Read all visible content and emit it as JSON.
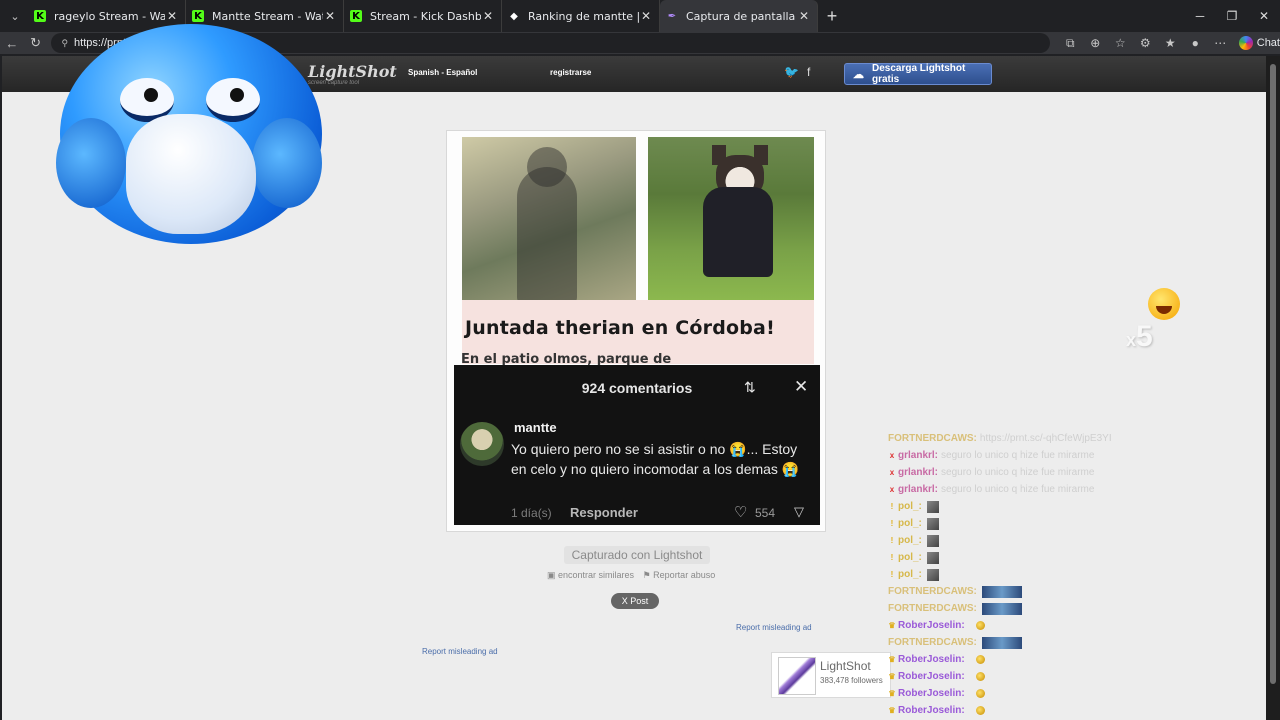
{
  "browser": {
    "tabs": [
      {
        "label": "rageylo Stream - Watch Live on Ki",
        "favicon": "kick-icon",
        "active": false
      },
      {
        "label": "Mantte Stream - Watch Live on Ki",
        "favicon": "kick-icon",
        "active": false
      },
      {
        "label": "Stream - Kick Dashboard",
        "favicon": "kick-icon",
        "active": false
      },
      {
        "label": "Ranking de mantte | El mejor softw",
        "favicon": "gem-icon",
        "active": false
      },
      {
        "label": "Captura de pantalla por Lightshot",
        "favicon": "lightshot-feather-icon",
        "active": true
      }
    ],
    "url": "https://prnt",
    "chat_label": "Chat"
  },
  "lightshot_header": {
    "logo_name": "LightShot",
    "logo_tag": "screen capture tool",
    "language": "Spanish - Español",
    "register": "registrarse",
    "download_button": "Descarga Lightshot gratis"
  },
  "screenshot_card": {
    "headline": "Juntada therian en Córdoba!",
    "subline": "En el patio olmos, parque de",
    "comments_count": "924 comentarios",
    "comment": {
      "user": "mantte",
      "text": "Yo quiero pero no se si asistir o no 😭... Estoy en celo y no quiero incomodar a los demas 😭",
      "time": "1 día(s)",
      "reply": "Responder",
      "likes": "554"
    }
  },
  "footer": {
    "captured_with": "Capturado con Lightshot",
    "find_similar": "encontrar similares",
    "report_abuse": "Reportar abuso",
    "post_button": "X Post",
    "report_misleading_ad_1": "Report misleading ad",
    "report_misleading_ad_2": "Report misleading ad"
  },
  "lightshot_box": {
    "name": "LightShot",
    "followers": "383,478 followers"
  },
  "overlay": {
    "multiplier_x": "x",
    "multiplier_n": "5"
  },
  "chat": [
    {
      "user": "FORTNERDCAWS:",
      "color": "#d9c07a",
      "badge": "",
      "msg": "https://prnt.sc/-qhCfeWjpE3YI",
      "emote": ""
    },
    {
      "user": "grlankrl:",
      "color": "#c86aa4",
      "badge": "x",
      "msg": "seguro lo unico q hize fue mirarme",
      "emote": ""
    },
    {
      "user": "grlankrl:",
      "color": "#c86aa4",
      "badge": "x",
      "msg": "seguro lo unico q hize fue mirarme",
      "emote": ""
    },
    {
      "user": "grlankrl:",
      "color": "#c86aa4",
      "badge": "x",
      "msg": "seguro lo unico q hize fue mirarme",
      "emote": ""
    },
    {
      "user": "pol_:",
      "color": "#d6b84a",
      "badge": "!",
      "msg": "",
      "emote": "sq"
    },
    {
      "user": "pol_:",
      "color": "#d6b84a",
      "badge": "!",
      "msg": "",
      "emote": "sq"
    },
    {
      "user": "pol_:",
      "color": "#d6b84a",
      "badge": "!",
      "msg": "",
      "emote": "sq"
    },
    {
      "user": "pol_:",
      "color": "#d6b84a",
      "badge": "!",
      "msg": "",
      "emote": "sq"
    },
    {
      "user": "pol_:",
      "color": "#d6b84a",
      "badge": "!",
      "msg": "",
      "emote": "sq"
    },
    {
      "user": "FORTNERDCAWS:",
      "color": "#d9c07a",
      "badge": "",
      "msg": "",
      "emote": "wide"
    },
    {
      "user": "FORTNERDCAWS:",
      "color": "#d9c07a",
      "badge": "",
      "msg": "",
      "emote": "wide"
    },
    {
      "user": "RoberJoselin:",
      "color": "#9a5ad8",
      "badge": "♛",
      "msg": "",
      "emote": "dot"
    },
    {
      "user": "FORTNERDCAWS:",
      "color": "#d9c07a",
      "badge": "",
      "msg": "",
      "emote": "wide"
    },
    {
      "user": "RoberJoselin:",
      "color": "#9a5ad8",
      "badge": "♛",
      "msg": "",
      "emote": "dot"
    },
    {
      "user": "RoberJoselin:",
      "color": "#9a5ad8",
      "badge": "♛",
      "msg": "",
      "emote": "dot"
    },
    {
      "user": "RoberJoselin:",
      "color": "#9a5ad8",
      "badge": "♛",
      "msg": "",
      "emote": "dot"
    },
    {
      "user": "RoberJoselin:",
      "color": "#9a5ad8",
      "badge": "♛",
      "msg": "",
      "emote": "dot"
    }
  ]
}
